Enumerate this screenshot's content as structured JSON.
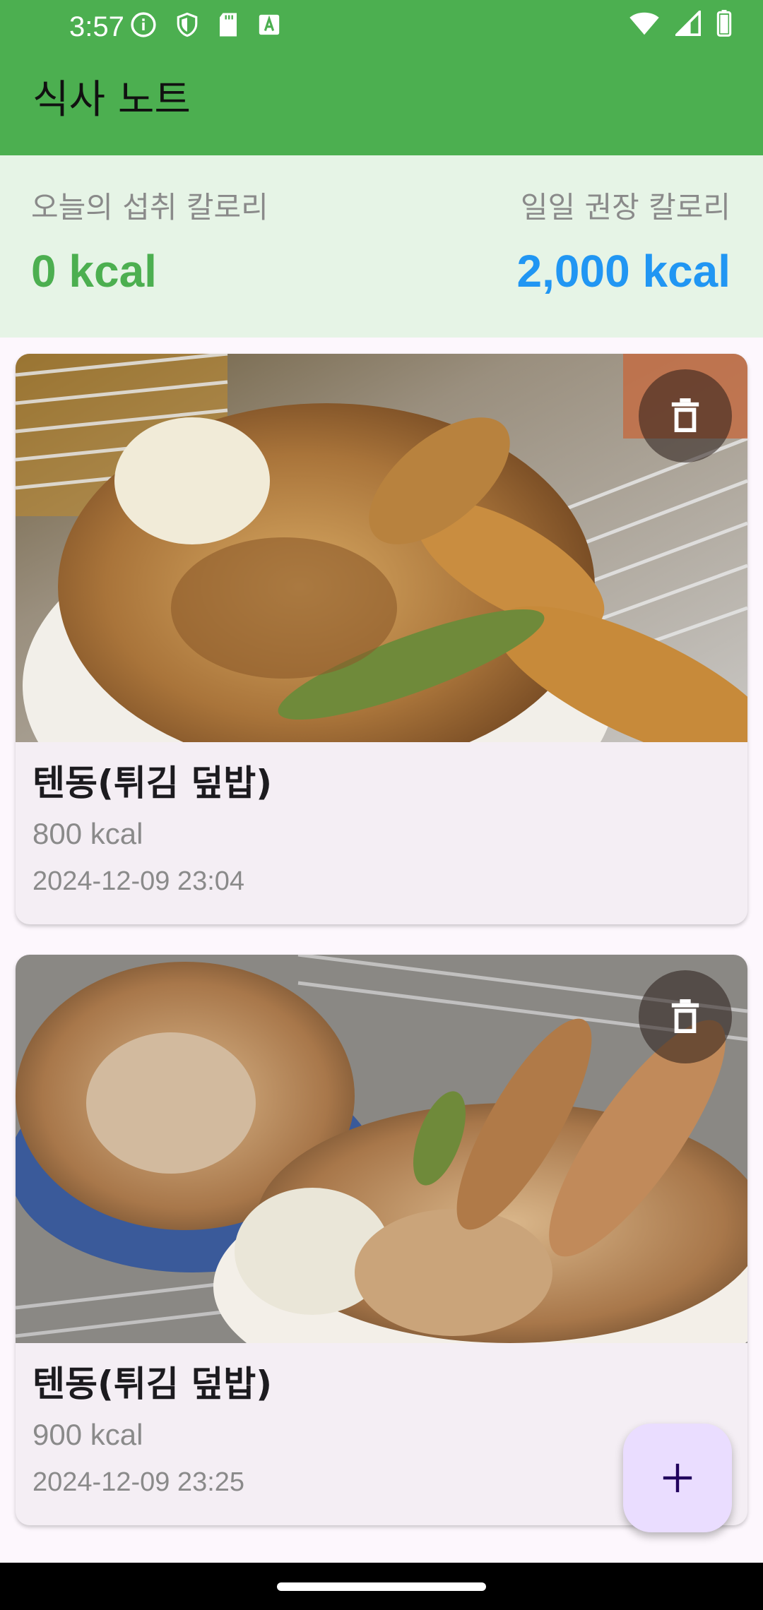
{
  "status_bar": {
    "time": "3:57",
    "icons_left": [
      "info-icon",
      "shield-icon",
      "sd-card-icon",
      "text-a-icon"
    ],
    "icons_right": [
      "wifi-icon",
      "cell-signal-icon",
      "battery-icon"
    ]
  },
  "app_bar": {
    "title": "식사 노트",
    "color": "#4caf50"
  },
  "summary": {
    "today_label": "오늘의 섭취 칼로리",
    "today_value": "0 kcal",
    "today_color": "#4caf50",
    "recommended_label": "일일 권장 칼로리",
    "recommended_value": "2,000 kcal",
    "recommended_color": "#2196f3"
  },
  "meals": [
    {
      "name": "텐동(튀김 덮밥)",
      "calories": "800 kcal",
      "datetime": "2024-12-09 23:04",
      "photo_icon": "tendon-photo",
      "action_icon": "trash-icon"
    },
    {
      "name": "텐동(튀김 덮밥)",
      "calories": "900 kcal",
      "datetime": "2024-12-09 23:25",
      "photo_icon": "tendon-photo",
      "action_icon": "trash-icon"
    }
  ],
  "fab": {
    "icon": "plus-icon",
    "color": "#eaddff"
  }
}
